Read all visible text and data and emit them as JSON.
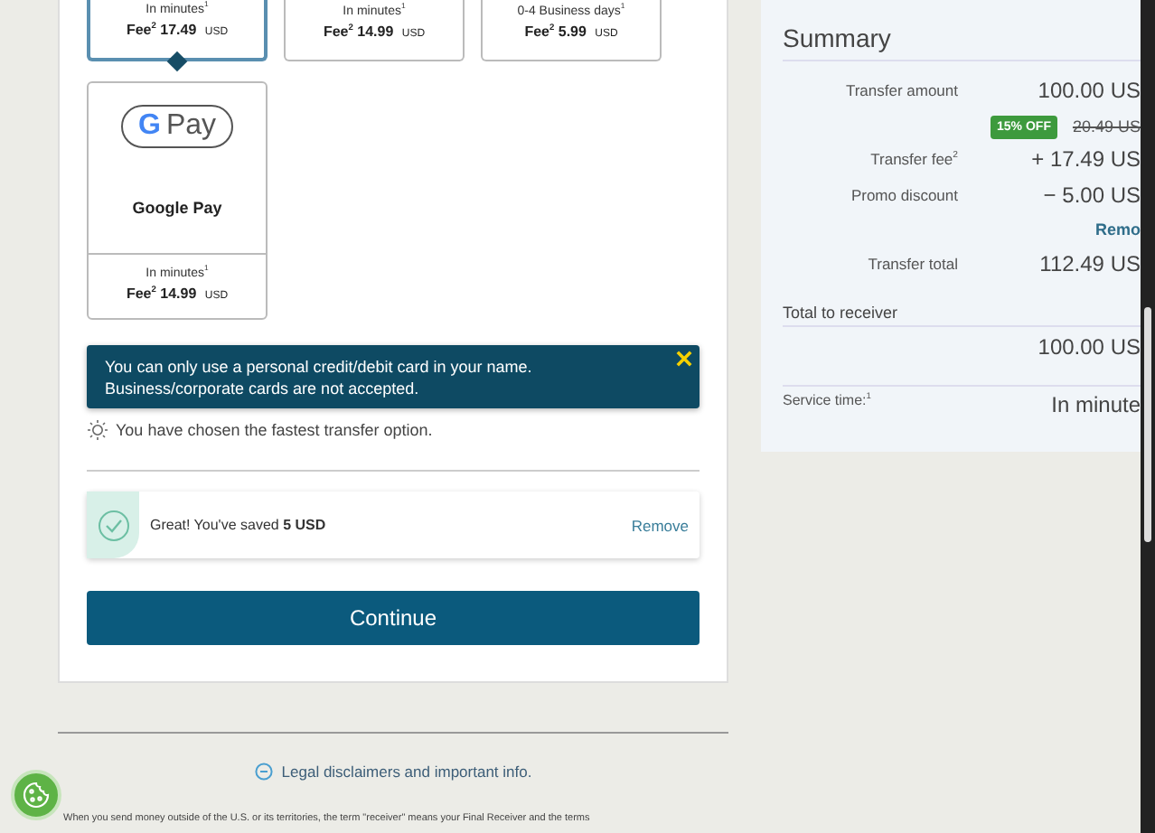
{
  "transfer_options": [
    {
      "speed": "In minutes$^{1}$",
      "fee": "Fee$^{2}$ 17.49",
      "currency": "USD",
      "selected": true
    },
    {
      "speed": "In minutes$^{1}$",
      "fee": "Fee$^{2}$ 14.99",
      "currency": "USD",
      "selected": false
    },
    {
      "speed": "0-4 Business days$^{1}$",
      "fee": "Fee$^{2}$ 5.99",
      "currency": "USD",
      "selected": false
    }
  ],
  "wallet_option": {
    "logo_letter": "G",
    "logo_word": "Pay",
    "name": "Google Pay",
    "speed": "In minutes$^{1}$",
    "fee": "Fee$^{2}$ 14.99",
    "currency": "USD",
    "selected": false
  },
  "alert": {
    "message": "You can only use a personal credit/debit card in your name. Business/corporate cards are not accepted."
  },
  "info_note": "You have chosen the fastest transfer option.",
  "promo": {
    "message": "Great! You've saved **5 USD**",
    "action": "Remove"
  },
  "continue_button": "Continue",
  "summary": {
    "title": "Summary",
    "rows": [
      {
        "kind": "line",
        "label": "Transfer amount",
        "value": "100.00 US"
      },
      {
        "kind": "discount",
        "badge": "15% OFF",
        "old_value": "20.49 US"
      },
      {
        "kind": "line",
        "label": "Transfer fee$^{2}$",
        "value": "+ 17.49 US"
      },
      {
        "kind": "line",
        "label": "Promo discount",
        "value": "− 5.00 US"
      },
      {
        "kind": "link",
        "value": "Remo"
      },
      {
        "kind": "line",
        "label": "Transfer total",
        "value": "112.49 US"
      }
    ],
    "receiver": {
      "label": "Total  to receiver",
      "value": "100.00 US"
    },
    "service_time": {
      "label": "Service time:$^{1}$",
      "value": "In minute"
    }
  },
  "footer": {
    "legal_link": "Legal disclaimers and important info.",
    "disclaimer": "When you send money outside of the U.S. or its territories, the term \"receiver\" means your Final Receiver and the terms"
  }
}
